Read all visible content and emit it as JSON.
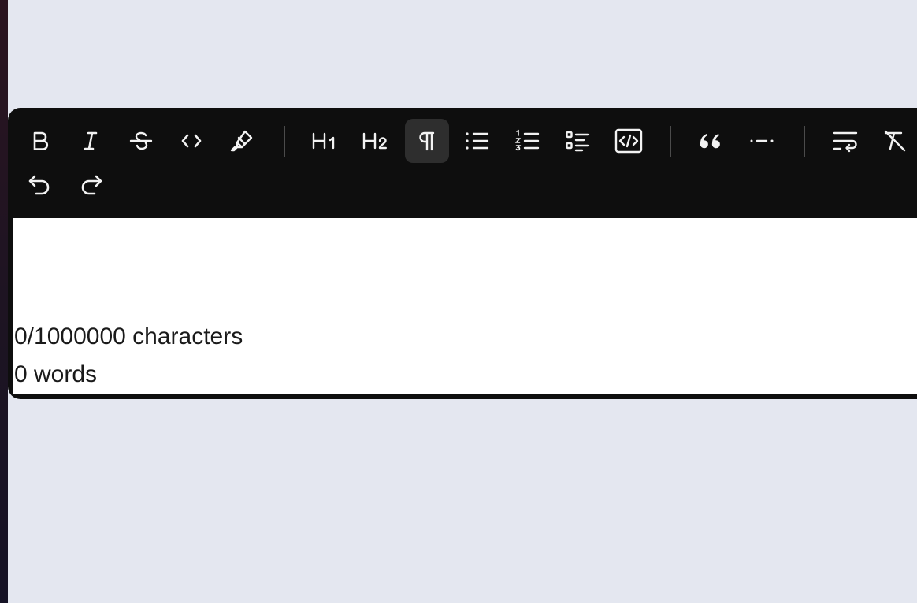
{
  "toolbar": {
    "buttons": [
      {
        "name": "bold-button",
        "icon": "bold-icon"
      },
      {
        "name": "italic-button",
        "icon": "italic-icon"
      },
      {
        "name": "strikethrough-button",
        "icon": "strikethrough-icon"
      },
      {
        "name": "inline-code-button",
        "icon": "code-icon"
      },
      {
        "name": "highlight-button",
        "icon": "highlighter-icon"
      },
      {
        "name": "heading-1-button",
        "icon": "heading-1-icon"
      },
      {
        "name": "heading-2-button",
        "icon": "heading-2-icon"
      },
      {
        "name": "paragraph-button",
        "icon": "pilcrow-icon",
        "active": true
      },
      {
        "name": "bullet-list-button",
        "icon": "bullet-list-icon"
      },
      {
        "name": "ordered-list-button",
        "icon": "ordered-list-icon"
      },
      {
        "name": "task-list-button",
        "icon": "task-list-icon"
      },
      {
        "name": "code-block-button",
        "icon": "code-block-icon"
      },
      {
        "name": "blockquote-button",
        "icon": "quote-icon"
      },
      {
        "name": "horizontal-rule-button",
        "icon": "horizontal-rule-icon"
      },
      {
        "name": "hard-break-button",
        "icon": "text-wrap-icon"
      },
      {
        "name": "clear-format-button",
        "icon": "clear-format-icon"
      },
      {
        "name": "undo-button",
        "icon": "undo-icon"
      },
      {
        "name": "redo-button",
        "icon": "redo-icon"
      }
    ],
    "heading1_label": "H1",
    "heading2_label": "H2"
  },
  "editor": {
    "characters_text": "0/1000000 characters",
    "words_text": "0 words"
  },
  "colors": {
    "toolbar_bg": "#0e0e0e",
    "active_bg": "#2e2e2e",
    "page_bg": "#e4e7f0"
  }
}
